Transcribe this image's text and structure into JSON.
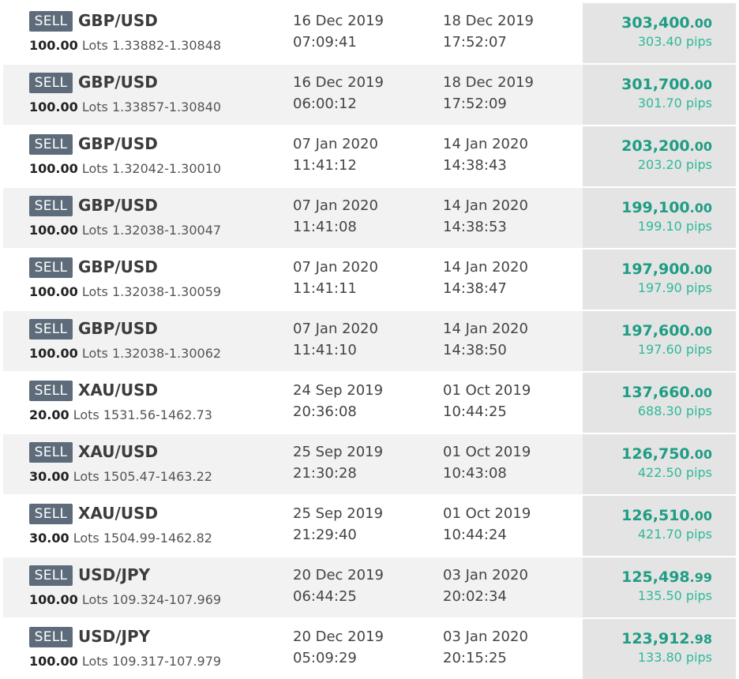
{
  "labels": {
    "lots": "Lots",
    "pips": "pips"
  },
  "trades": [
    {
      "side": "SELL",
      "symbol": "GBP/USD",
      "lots": "100.00",
      "price_range": "1.33882-1.30848",
      "open_date": "16 Dec 2019",
      "open_time": "07:09:41",
      "close_date": "18 Dec 2019",
      "close_time": "17:52:07",
      "profit_main": "303,400",
      "profit_cents": ".00",
      "pips": "303.40"
    },
    {
      "side": "SELL",
      "symbol": "GBP/USD",
      "lots": "100.00",
      "price_range": "1.33857-1.30840",
      "open_date": "16 Dec 2019",
      "open_time": "06:00:12",
      "close_date": "18 Dec 2019",
      "close_time": "17:52:09",
      "profit_main": "301,700",
      "profit_cents": ".00",
      "pips": "301.70"
    },
    {
      "side": "SELL",
      "symbol": "GBP/USD",
      "lots": "100.00",
      "price_range": "1.32042-1.30010",
      "open_date": "07 Jan 2020",
      "open_time": "11:41:12",
      "close_date": "14 Jan 2020",
      "close_time": "14:38:43",
      "profit_main": "203,200",
      "profit_cents": ".00",
      "pips": "203.20"
    },
    {
      "side": "SELL",
      "symbol": "GBP/USD",
      "lots": "100.00",
      "price_range": "1.32038-1.30047",
      "open_date": "07 Jan 2020",
      "open_time": "11:41:08",
      "close_date": "14 Jan 2020",
      "close_time": "14:38:53",
      "profit_main": "199,100",
      "profit_cents": ".00",
      "pips": "199.10"
    },
    {
      "side": "SELL",
      "symbol": "GBP/USD",
      "lots": "100.00",
      "price_range": "1.32038-1.30059",
      "open_date": "07 Jan 2020",
      "open_time": "11:41:11",
      "close_date": "14 Jan 2020",
      "close_time": "14:38:47",
      "profit_main": "197,900",
      "profit_cents": ".00",
      "pips": "197.90"
    },
    {
      "side": "SELL",
      "symbol": "GBP/USD",
      "lots": "100.00",
      "price_range": "1.32038-1.30062",
      "open_date": "07 Jan 2020",
      "open_time": "11:41:10",
      "close_date": "14 Jan 2020",
      "close_time": "14:38:50",
      "profit_main": "197,600",
      "profit_cents": ".00",
      "pips": "197.60"
    },
    {
      "side": "SELL",
      "symbol": "XAU/USD",
      "lots": "20.00",
      "price_range": "1531.56-1462.73",
      "open_date": "24 Sep 2019",
      "open_time": "20:36:08",
      "close_date": "01 Oct 2019",
      "close_time": "10:44:25",
      "profit_main": "137,660",
      "profit_cents": ".00",
      "pips": "688.30"
    },
    {
      "side": "SELL",
      "symbol": "XAU/USD",
      "lots": "30.00",
      "price_range": "1505.47-1463.22",
      "open_date": "25 Sep 2019",
      "open_time": "21:30:28",
      "close_date": "01 Oct 2019",
      "close_time": "10:43:08",
      "profit_main": "126,750",
      "profit_cents": ".00",
      "pips": "422.50"
    },
    {
      "side": "SELL",
      "symbol": "XAU/USD",
      "lots": "30.00",
      "price_range": "1504.99-1462.82",
      "open_date": "25 Sep 2019",
      "open_time": "21:29:40",
      "close_date": "01 Oct 2019",
      "close_time": "10:44:24",
      "profit_main": "126,510",
      "profit_cents": ".00",
      "pips": "421.70"
    },
    {
      "side": "SELL",
      "symbol": "USD/JPY",
      "lots": "100.00",
      "price_range": "109.324-107.969",
      "open_date": "20 Dec 2019",
      "open_time": "06:44:25",
      "close_date": "03 Jan 2020",
      "close_time": "20:02:34",
      "profit_main": "125,498",
      "profit_cents": ".99",
      "pips": "135.50"
    },
    {
      "side": "SELL",
      "symbol": "USD/JPY",
      "lots": "100.00",
      "price_range": "109.317-107.979",
      "open_date": "20 Dec 2019",
      "open_time": "05:09:29",
      "close_date": "03 Jan 2020",
      "close_time": "20:15:25",
      "profit_main": "123,912",
      "profit_cents": ".98",
      "pips": "133.80"
    }
  ],
  "colors": {
    "badge_bg": "#5d6b7a",
    "profit": "#1f9d84",
    "pips": "#2fb99a"
  }
}
